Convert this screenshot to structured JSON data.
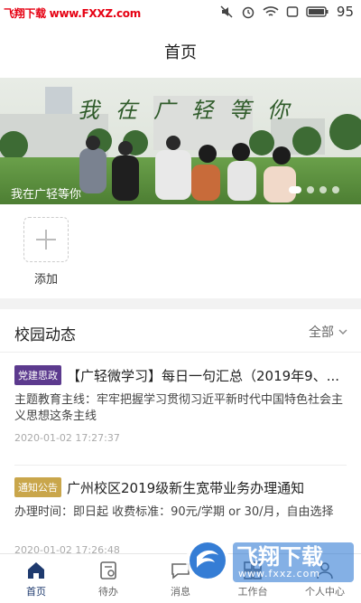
{
  "status_bar": {
    "watermark": "飞翔下载 www.FXXZ.com",
    "battery": "95"
  },
  "header": {
    "title": "首页"
  },
  "banner": {
    "overlay_text": "我在广轻等你",
    "caption": "我在广轻等你"
  },
  "shortcuts": [
    {
      "label": "添加",
      "icon": "plus-icon"
    }
  ],
  "news": {
    "title": "校园动态",
    "filter": "全部",
    "items": [
      {
        "tag": "党建思政",
        "tag_color": "#5c3a8e",
        "title": "【广轻微学习】每日一句汇总（2019年9、...",
        "desc": "主题教育主线：牢牢把握学习贯彻习近平新时代中国特色社会主义思想这条主线",
        "time": "2020-01-02 17:27:37"
      },
      {
        "tag": "通知公告",
        "tag_color": "#c9a64b",
        "title": "广州校区2019级新生宽带业务办理通知",
        "desc": "办理时间：即日起 收费标准：90元/学期 or 30/月，自由选择",
        "time": "2020-01-02 17:26:48"
      }
    ]
  },
  "tabs": [
    {
      "label": "首页",
      "icon": "home-icon"
    },
    {
      "label": "待办",
      "icon": "todo-icon"
    },
    {
      "label": "消息",
      "icon": "message-icon"
    },
    {
      "label": "工作台",
      "icon": "workbench-icon"
    },
    {
      "label": "个人中心",
      "icon": "user-icon"
    }
  ],
  "watermark_logo": {
    "brand": "飞翔下载",
    "url": "www.fxxz.com"
  },
  "colors": {
    "primary": "#1e3a6e",
    "tag_party": "#5c3a8e",
    "tag_notice": "#c9a64b"
  }
}
